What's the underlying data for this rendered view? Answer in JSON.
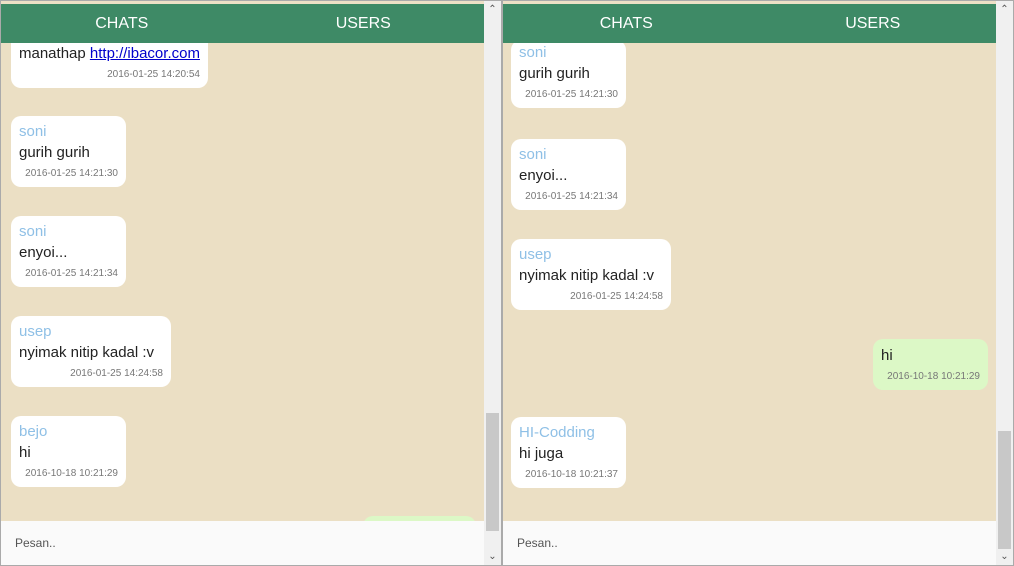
{
  "tabs": {
    "chats": "CHATS",
    "users": "USERS"
  },
  "input_placeholder": "Pesan..",
  "colors": {
    "header": "#3e8a66",
    "background": "#ebdfc4",
    "own_bubble": "#dcf8c6",
    "sender": "#8fc0e6"
  },
  "left": {
    "messages": [
      {
        "text": "manathap ",
        "link": "http://ibacor.com",
        "time": "2016-01-25 14:20:54"
      },
      {
        "name": "soni",
        "text": "gurih gurih",
        "time": "2016-01-25 14:21:30"
      },
      {
        "name": "soni",
        "text": "enyoi...",
        "time": "2016-01-25 14:21:34"
      },
      {
        "name": "usep",
        "text": "nyimak nitip kadal :v",
        "time": "2016-01-25 14:24:58"
      },
      {
        "name": "bejo",
        "text": "hi",
        "time": "2016-10-18 10:21:29"
      }
    ]
  },
  "right": {
    "messages": [
      {
        "name": "soni",
        "text": "gurih gurih",
        "time": "2016-01-25 14:21:30"
      },
      {
        "name": "soni",
        "text": "enyoi...",
        "time": "2016-01-25 14:21:34"
      },
      {
        "name": "usep",
        "text": "nyimak nitip kadal :v",
        "time": "2016-01-25 14:24:58"
      },
      {
        "text": "hi",
        "time": "2016-10-18 10:21:29"
      },
      {
        "name": "HI-Codding",
        "text": "hi juga",
        "time": "2016-10-18 10:21:37"
      }
    ]
  }
}
